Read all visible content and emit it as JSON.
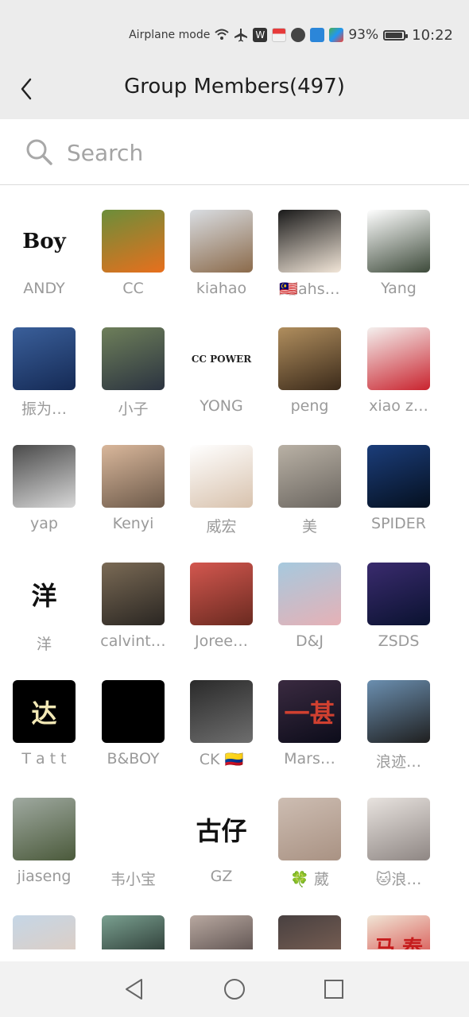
{
  "status": {
    "mode": "Airplane mode",
    "battery": "93%",
    "battery_level": 0.93,
    "time": "10:22"
  },
  "header": {
    "title": "Group Members(497)"
  },
  "search": {
    "placeholder": "Search"
  },
  "members": [
    {
      "name": "ANDY",
      "c1": "#ffffff",
      "c2": "#ffffff",
      "glyph": "Boy",
      "gc": "#111111"
    },
    {
      "name": "CC",
      "c1": "#6b8e3a",
      "c2": "#e86f1d",
      "glyph": "",
      "gc": "#ffffff"
    },
    {
      "name": "kiahao",
      "c1": "#d9dde2",
      "c2": "#8b6a4a",
      "glyph": "",
      "gc": "#ffffff"
    },
    {
      "name": "🇲🇾ahs…",
      "c1": "#1a1a1a",
      "c2": "#f2e6d8",
      "glyph": "",
      "gc": "#ffffff"
    },
    {
      "name": "Yang",
      "c1": "#ffffff",
      "c2": "#3d4a3a",
      "glyph": "",
      "gc": "#ffffff"
    },
    {
      "name": "振为…",
      "c1": "#3a5f9a",
      "c2": "#152a55",
      "glyph": "",
      "gc": "#ffffff"
    },
    {
      "name": "小子",
      "c1": "#6e7f5a",
      "c2": "#2b3340",
      "glyph": "",
      "gc": "#ffffff"
    },
    {
      "name": "YONG",
      "c1": "#ffffff",
      "c2": "#ffffff",
      "glyph": "CC POWER",
      "gc": "#222222"
    },
    {
      "name": "peng",
      "c1": "#b08e5e",
      "c2": "#3b2a1a",
      "glyph": "",
      "gc": "#ffffff"
    },
    {
      "name": "xiao z…",
      "c1": "#f4f0ee",
      "c2": "#c9232e",
      "glyph": "",
      "gc": "#ffffff"
    },
    {
      "name": "yap",
      "c1": "#4a4a4a",
      "c2": "#d8d8d8",
      "glyph": "",
      "gc": "#ffffff"
    },
    {
      "name": "Kenyi",
      "c1": "#d9b79b",
      "c2": "#6d5a4a",
      "glyph": "",
      "gc": "#ffffff"
    },
    {
      "name": "威宏",
      "c1": "#ffffff",
      "c2": "#d8c2ad",
      "glyph": "",
      "gc": "#ffffff"
    },
    {
      "name": "美",
      "c1": "#b9b1a5",
      "c2": "#6b6660",
      "glyph": "",
      "gc": "#ffffff"
    },
    {
      "name": "SPIDER",
      "c1": "#1b3d7a",
      "c2": "#05101f",
      "glyph": "",
      "gc": "#ffffff"
    },
    {
      "name": "洋",
      "c1": "#ffffff",
      "c2": "#ffffff",
      "glyph": "洋",
      "gc": "#111111"
    },
    {
      "name": "calvint…",
      "c1": "#7a6a55",
      "c2": "#2a2622",
      "glyph": "",
      "gc": "#ffffff"
    },
    {
      "name": "Joree…",
      "c1": "#d3574f",
      "c2": "#6a2a20",
      "glyph": "",
      "gc": "#ffffff"
    },
    {
      "name": "D&J",
      "c1": "#a6c9de",
      "c2": "#e6b1b6",
      "glyph": "",
      "gc": "#ffffff"
    },
    {
      "name": "ZSDS",
      "c1": "#3a2b6e",
      "c2": "#0a1230",
      "glyph": "",
      "gc": "#ffffff"
    },
    {
      "name": "T a t t",
      "c1": "#000000",
      "c2": "#000000",
      "glyph": "达",
      "gc": "#f2e8b5"
    },
    {
      "name": "B&BOY",
      "c1": "#000000",
      "c2": "#000000",
      "glyph": "",
      "gc": "#d4a72c"
    },
    {
      "name": "CK 🇨🇴",
      "c1": "#2a2a2a",
      "c2": "#6e6e6e",
      "glyph": "",
      "gc": "#ffffff"
    },
    {
      "name": "Mars…",
      "c1": "#3a2a40",
      "c2": "#0c0c1a",
      "glyph": "一甚",
      "gc": "#d04030"
    },
    {
      "name": "浪迹…",
      "c1": "#6b8fb0",
      "c2": "#1f1f1f",
      "glyph": "",
      "gc": "#ffffff"
    },
    {
      "name": "jiaseng",
      "c1": "#9fa9a0",
      "c2": "#4b5a3b",
      "glyph": "",
      "gc": "#ffffff"
    },
    {
      "name": "韦小宝",
      "c1": "#ffffff",
      "c2": "#ffffff",
      "glyph": "",
      "gc": "#ffffff"
    },
    {
      "name": "GZ",
      "c1": "#ffffff",
      "c2": "#ffffff",
      "glyph": "古仔",
      "gc": "#111111"
    },
    {
      "name": "🍀 葳",
      "c1": "#cdbdb2",
      "c2": "#a99283",
      "glyph": "",
      "gc": "#ffffff"
    },
    {
      "name": "🐱浪…",
      "c1": "#e8e3df",
      "c2": "#8e8683",
      "glyph": "",
      "gc": "#ffffff"
    },
    {
      "name": "",
      "c1": "#c5d6e6",
      "c2": "#e7cbb7",
      "glyph": "",
      "gc": "#ffffff"
    },
    {
      "name": "",
      "c1": "#7aa090",
      "c2": "#101614",
      "glyph": "",
      "gc": "#ffffff"
    },
    {
      "name": "",
      "c1": "#b8a8a0",
      "c2": "#3a3030",
      "glyph": "",
      "gc": "#ffffff"
    },
    {
      "name": "",
      "c1": "#484040",
      "c2": "#8a6a5a",
      "glyph": "",
      "gc": "#ffffff"
    },
    {
      "name": "",
      "c1": "#f0e6d6",
      "c2": "#d12b2b",
      "glyph": "马 泰",
      "gc": "#c61d1d"
    }
  ],
  "nav": {
    "back_icon": "triangle-back-icon",
    "home_icon": "circle-home-icon",
    "recents_icon": "square-recents-icon"
  }
}
